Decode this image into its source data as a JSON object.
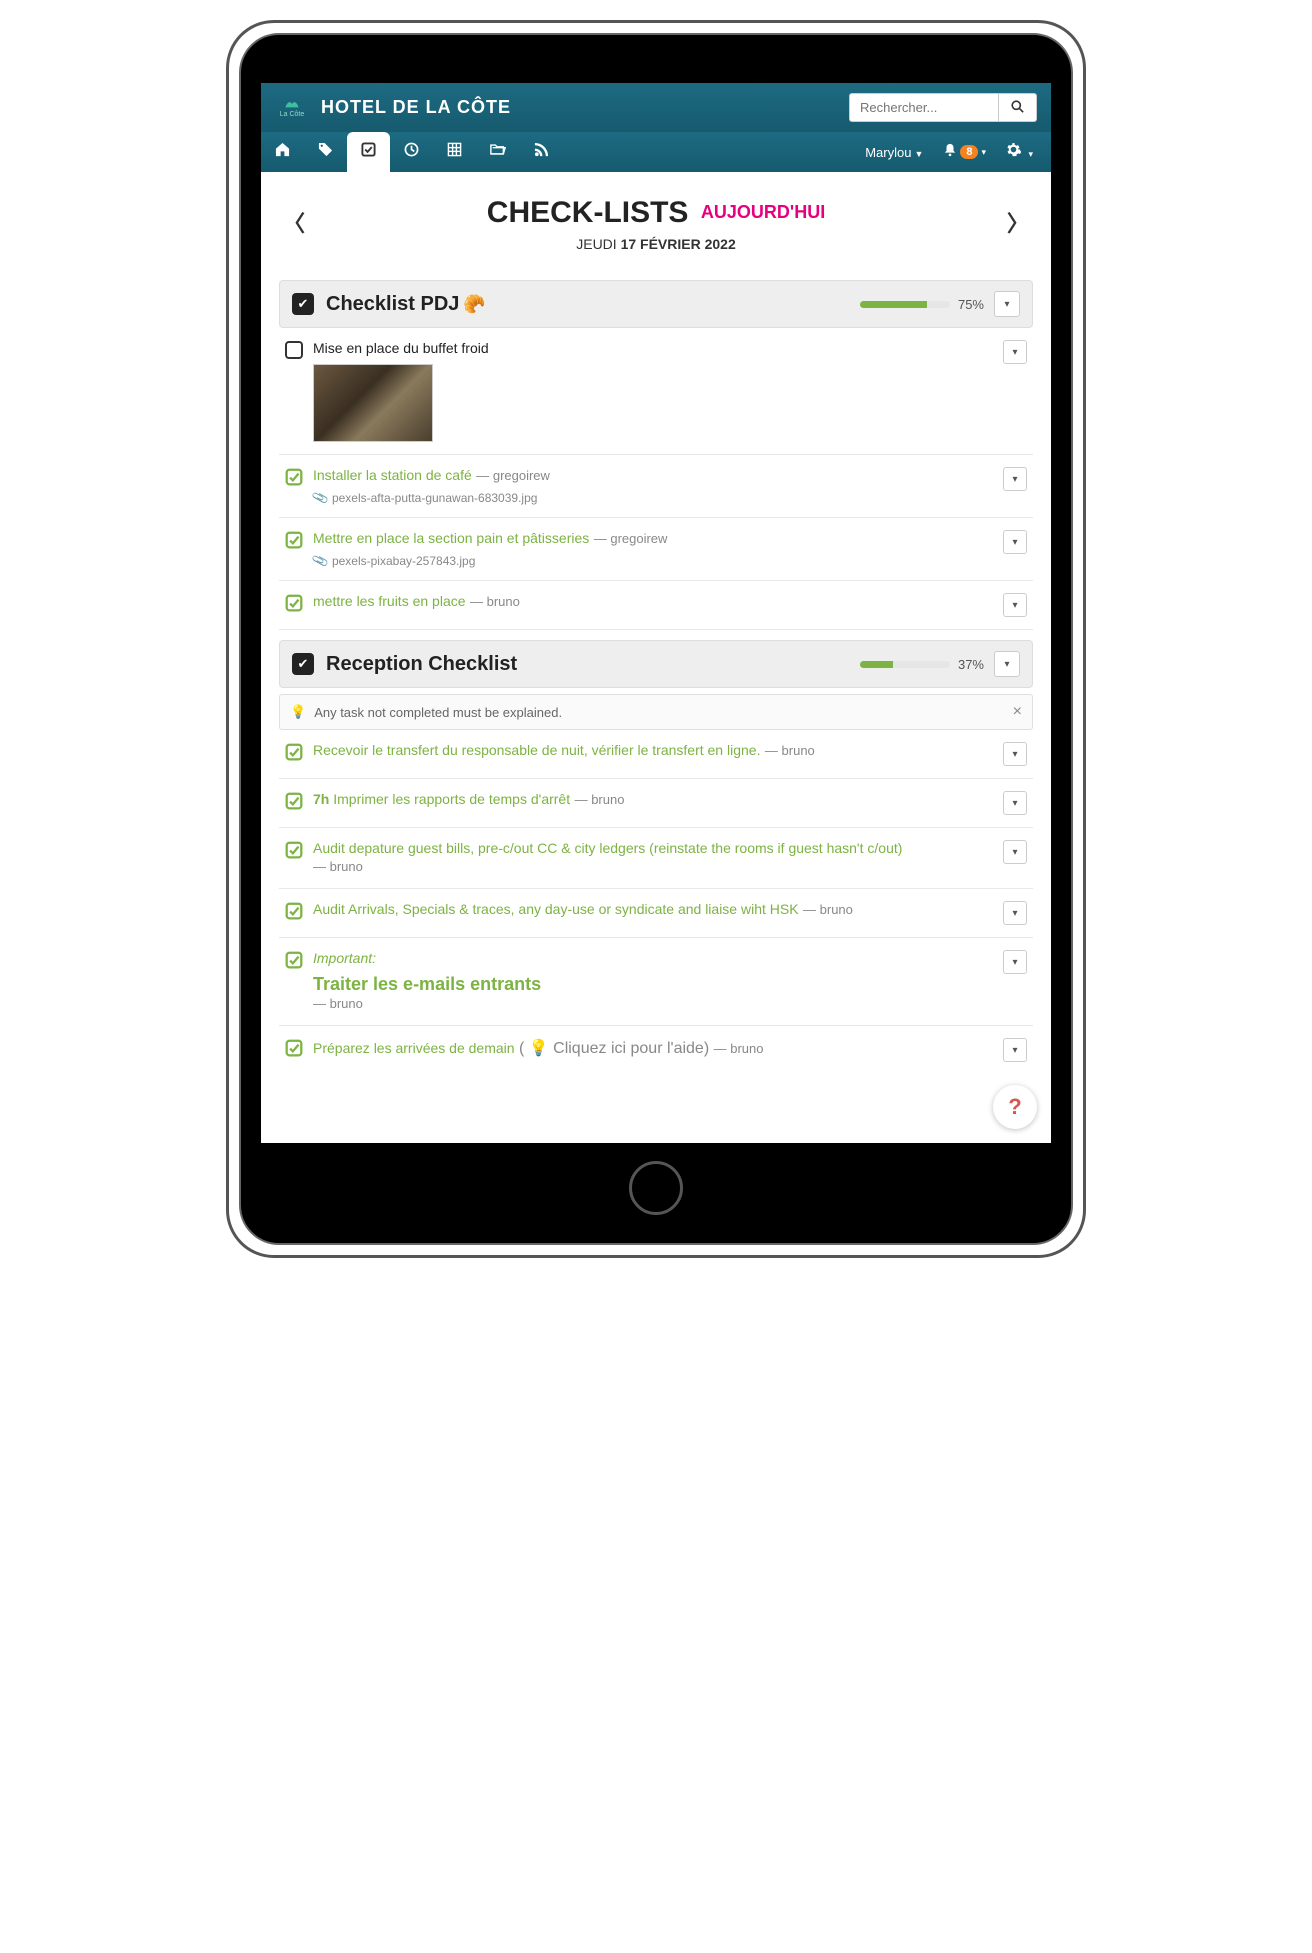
{
  "header": {
    "brand_small": "La Côte",
    "hotel_name": "HOTEL DE LA CÔTE",
    "search_placeholder": "Rechercher..."
  },
  "nav": {
    "user_name": "Marylou",
    "notif_count": "8"
  },
  "page": {
    "title": "CHECK-LISTS",
    "subtitle": "AUJOURD'HUI",
    "date_dow": "JEUDI",
    "date_rest": "17 FÉVRIER 2022"
  },
  "list1": {
    "title": "Checklist PDJ",
    "emoji": "🥐",
    "progress_pct": "75%",
    "progress_val": 75,
    "tasks": {
      "t0": {
        "label": "Mise en place du buffet froid"
      },
      "t1": {
        "label": "Installer la station de café",
        "author": "gregoirew",
        "attach": "pexels-afta-putta-gunawan-683039.jpg"
      },
      "t2": {
        "label": "Mettre en place la section pain et pâtisseries",
        "author": "gregoirew",
        "attach": "pexels-pixabay-257843.jpg"
      },
      "t3": {
        "label": "mettre les fruits en place",
        "author": "bruno"
      }
    }
  },
  "list2": {
    "title": "Reception Checklist",
    "progress_pct": "37%",
    "progress_val": 37,
    "note": "Any task not completed must be explained.",
    "tasks": {
      "t0": {
        "label": "Recevoir le transfert du responsable de nuit, vérifier le transfert en ligne.",
        "author": "bruno"
      },
      "t1": {
        "prefix": "7h",
        "label": "Imprimer les rapports de temps d'arrêt",
        "author": "bruno"
      },
      "t2": {
        "label": "Audit depature guest bills, pre-c/out CC & city ledgers (reinstate the rooms if guest hasn't c/out)",
        "author": "bruno"
      },
      "t3": {
        "label": "Audit Arrivals, Specials & traces, any day-use or syndicate and liaise wiht HSK",
        "author": "bruno"
      },
      "t4": {
        "label": "Important:",
        "big": "Traiter les e-mails entrants",
        "author": "bruno"
      },
      "t5": {
        "label": "Préparez les arrivées de demain",
        "hint": "Cliquez ici pour l'aide",
        "author": "bruno"
      }
    }
  },
  "help_fab": "?"
}
